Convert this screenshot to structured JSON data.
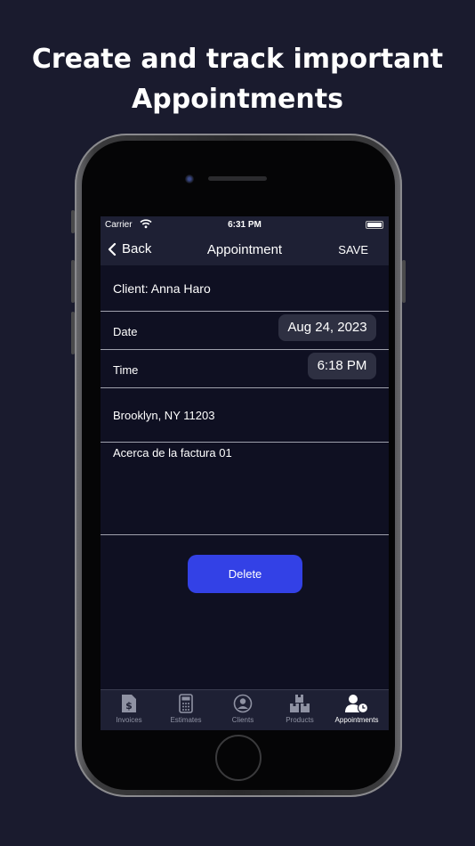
{
  "headline": {
    "line1": "Create and track important",
    "line2": "Appointments"
  },
  "status_bar": {
    "carrier": "Carrier",
    "time": "6:31 PM"
  },
  "nav": {
    "back_label": "Back",
    "title": "Appointment",
    "save_label": "SAVE"
  },
  "form": {
    "client": "Client: Anna Haro",
    "date_label": "Date",
    "date_value": "Aug 24, 2023",
    "time_label": "Time",
    "time_value": "6:18 PM",
    "address": "Brooklyn, NY 11203",
    "notes": "Acerca de la factura 01"
  },
  "actions": {
    "delete_label": "Delete"
  },
  "tabs": [
    {
      "label": "Invoices",
      "icon": "invoice-icon"
    },
    {
      "label": "Estimates",
      "icon": "calculator-icon"
    },
    {
      "label": "Clients",
      "icon": "person-circle-icon"
    },
    {
      "label": "Products",
      "icon": "boxes-icon"
    },
    {
      "label": "Appointments",
      "icon": "person-clock-icon",
      "active": true
    }
  ],
  "colors": {
    "background": "#1a1b2e",
    "screen": "#0f1022",
    "bars": "#1e2034",
    "accent": "#3341e6",
    "inactive_tab": "#8f92a3"
  }
}
